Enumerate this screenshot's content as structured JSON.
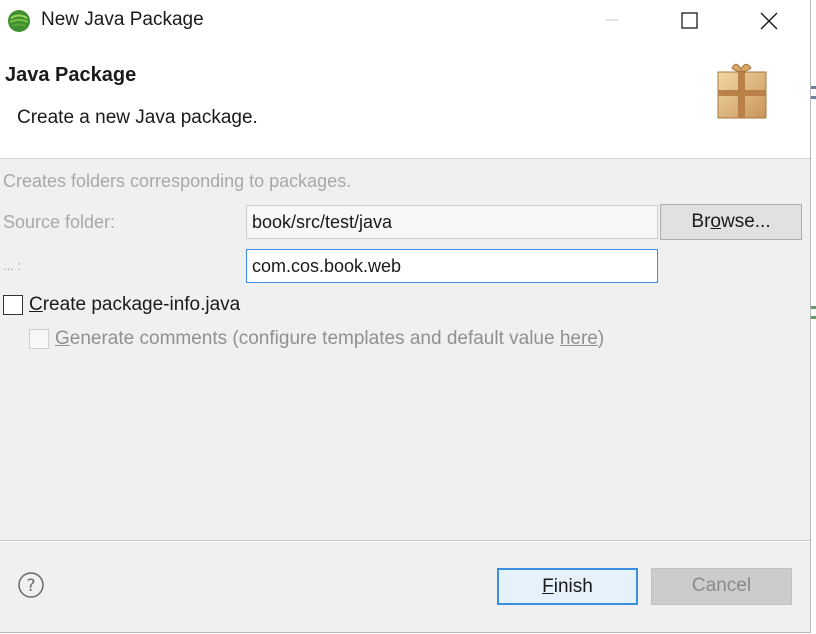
{
  "window": {
    "title": "New Java Package",
    "icon": "eclipse-icon",
    "controls": [
      "minimize-icon",
      "maximize-icon",
      "close-icon"
    ]
  },
  "banner": {
    "title": "Java Package",
    "description": "Create a new Java package.",
    "icon": "package-gift-icon"
  },
  "form": {
    "info": "Creates folders corresponding to packages.",
    "source_folder_label": "Source folder:",
    "source_folder_value": "book/src/test/java",
    "browse_label_pre": "Br",
    "browse_label_mnemonic": "o",
    "browse_label_post": "wse...",
    "name_label": "... :",
    "name_value": "com.cos.book.web",
    "create_info_mnemonic": "C",
    "create_info_rest": "reate package-info.java",
    "create_info_checked": false,
    "generate_mnemonic": "G",
    "generate_rest": "enerate comments (configure templates and default value ",
    "generate_link": "here",
    "generate_close": ")",
    "generate_checked": false
  },
  "footer": {
    "help_icon": "help-icon",
    "finish_mnemonic": "F",
    "finish_rest": "inish",
    "cancel_label": "Cancel"
  },
  "colors": {
    "accent": "#3b8ee0",
    "dialog_bg": "#f0f0f0",
    "disabled_text": "#a8a8a8"
  }
}
